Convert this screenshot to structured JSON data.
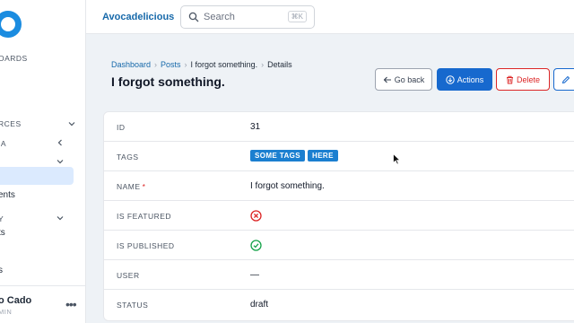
{
  "sidebar": {
    "section_dashboards": "OARDS",
    "section_resources": "RCES",
    "item_a": "IA",
    "item_comments": "ents",
    "section_category": "Y",
    "item_posts": "ts",
    "item_reviews": "s",
    "user_name": "o Cado",
    "user_role": "MIN",
    "more": "•••"
  },
  "topbar": {
    "app_name": "Avocadelicious",
    "search_placeholder": "Search",
    "search_shortcut": "⌘K"
  },
  "breadcrumb": {
    "items": [
      "Dashboard",
      "Posts",
      "I forgot something.",
      "Details"
    ]
  },
  "page": {
    "title": "I forgot something."
  },
  "actions": {
    "go_back": "Go back",
    "actions": "Actions",
    "delete": "Delete"
  },
  "details": {
    "id": {
      "label": "ID",
      "value": "31"
    },
    "tags": {
      "label": "TAGS",
      "values": [
        "SOME TAGS",
        "HERE"
      ]
    },
    "name": {
      "label": "NAME",
      "required": "*",
      "value": "I forgot something."
    },
    "is_featured": {
      "label": "IS FEATURED",
      "value": false
    },
    "is_published": {
      "label": "IS PUBLISHED",
      "value": true
    },
    "user": {
      "label": "USER",
      "value": "—"
    },
    "status": {
      "label": "STATUS",
      "value": "draft"
    }
  },
  "colors": {
    "accent": "#1769ce",
    "danger": "#dc2626",
    "success": "#16a34a",
    "tag": "#1b7fd0"
  }
}
